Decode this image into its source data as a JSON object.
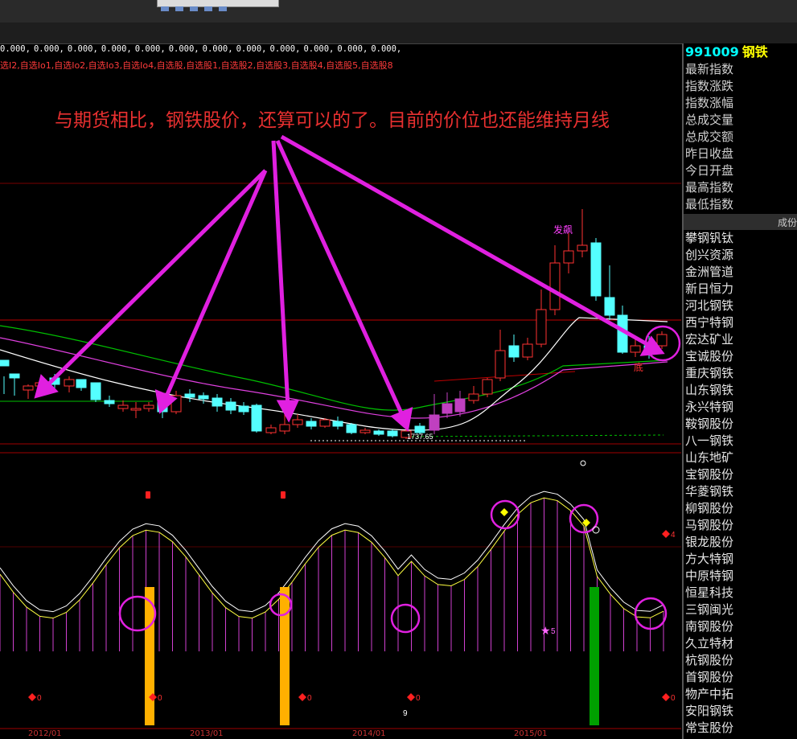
{
  "params_line": [
    "0.000,",
    "0.000,",
    "0.000,",
    "0.000,",
    "0.000,",
    "0.000,",
    "0.000,",
    "0.000,",
    "0.000,",
    "0.000,",
    "0.000,",
    "0.000,"
  ],
  "formula_line": "选I2,自选Io1,自选Io2,自选Io3,自选Io4,自选股,自选股1,自选股2,自选股3,自选股4,自选股5,自选股8",
  "annotation": "与期货相比，钢铁股价，还算可以的了。目前的价位也还能维持月线",
  "sidebar": {
    "code": "991009",
    "name": "钢铁",
    "fields": [
      "最新指数",
      "指数涨跌",
      "指数涨幅",
      "总成交量",
      "总成交额",
      "昨日收盘",
      "今日开盘",
      "最高指数",
      "最低指数"
    ],
    "header_label": "成份",
    "stocks": [
      "攀钢钒钛",
      "创兴资源",
      "金洲管道",
      "新日恒力",
      "河北钢铁",
      "西宁特钢",
      "宏达矿业",
      "宝诚股份",
      "重庆钢铁",
      "山东钢铁",
      "永兴特钢",
      "鞍钢股份",
      "八一钢铁",
      "山东地矿",
      "宝钢股份",
      "华菱钢铁",
      "柳钢股份",
      "马钢股份",
      "银龙股份",
      "方大特钢",
      "中原特钢",
      "恒星科技",
      "三钢闽光",
      "南钢股份",
      "久立特材",
      "杭钢股份",
      "首钢股份",
      "物产中拓",
      "安阳钢铁",
      "常宝股份"
    ]
  },
  "chart_labels": {
    "fa_bao": "发飙",
    "di": "底",
    "price_min": "1737.65",
    "star_label": "5"
  },
  "dates": [
    "2012/01",
    "2013/01",
    "2014/01",
    "2015/01"
  ],
  "colors": {
    "up": "#ff3232",
    "down": "#54ffff",
    "ma_white": "#ffffff",
    "ma_green": "#00c000",
    "ma_magenta": "#e040e0",
    "arrow": "#e020e0"
  }
}
